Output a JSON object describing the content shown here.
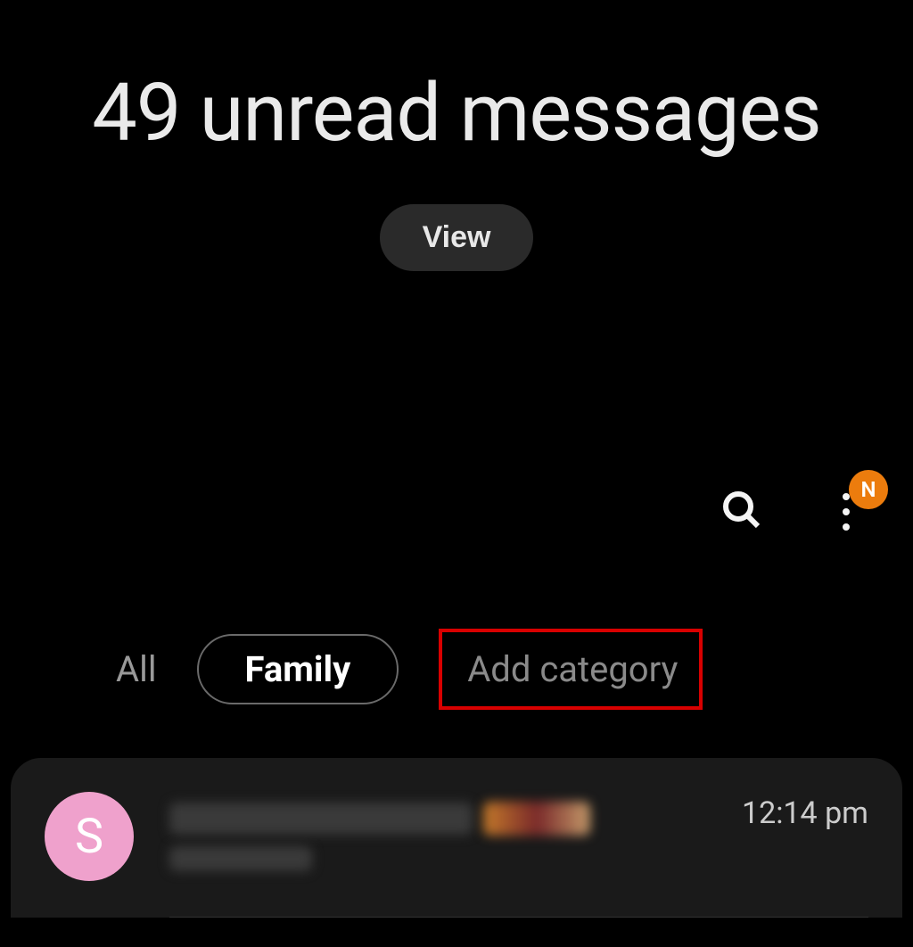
{
  "header": {
    "unread_count": 49,
    "unread_label": "49 unread messages",
    "view_button": "View"
  },
  "toolbar": {
    "notification_badge": "N"
  },
  "categories": {
    "all": "All",
    "family": "Family",
    "add": "Add category"
  },
  "conversations": [
    {
      "avatar_letter": "S",
      "time": "12:14 pm"
    }
  ]
}
